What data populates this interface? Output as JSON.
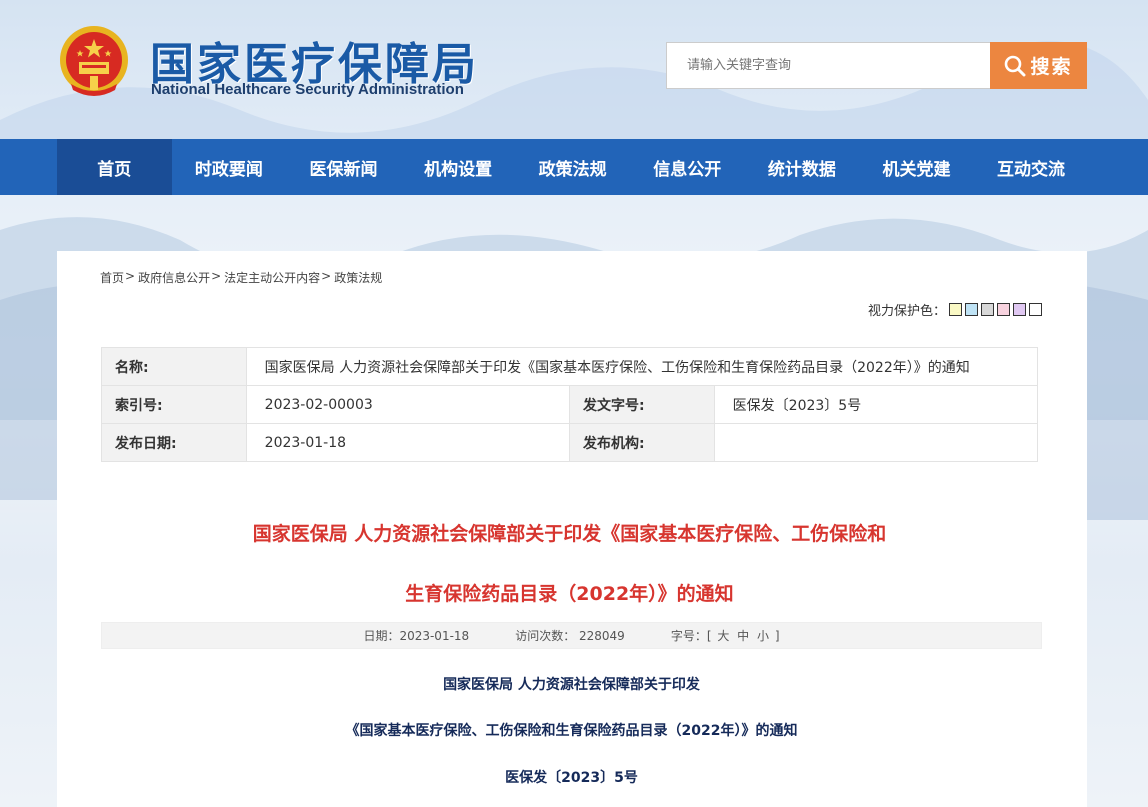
{
  "header": {
    "title_cn": "国家医疗保障局",
    "title_en": "National Healthcare Security Administration",
    "search_placeholder": "请输入关键字查询",
    "search_button": "搜索"
  },
  "nav": {
    "items": [
      "首页",
      "时政要闻",
      "医保新闻",
      "机构设置",
      "政策法规",
      "信息公开",
      "统计数据",
      "机关党建",
      "互动交流"
    ]
  },
  "breadcrumb": [
    "首页",
    "政府信息公开",
    "法定主动公开内容",
    "政策法规"
  ],
  "eye_protect": {
    "label": "视力保护色：",
    "colors": [
      "#faf9c5",
      "#bfe3f5",
      "#d8d8d8",
      "#f8d3df",
      "#e0c8f2",
      "#ffffff"
    ]
  },
  "info": {
    "name_label": "名称:",
    "name_value": "国家医保局 人力资源社会保障部关于印发《国家基本医疗保险、工伤保险和生育保险药品目录（2022年）》的通知",
    "index_label": "索引号:",
    "index_value": "2023-02-00003",
    "doc_no_label": "发文字号:",
    "doc_no_value": "医保发〔2023〕5号",
    "date_label": "发布日期:",
    "date_value": "2023-01-18",
    "org_label": "发布机构:",
    "org_value": ""
  },
  "article": {
    "title_line1": "国家医保局 人力资源社会保障部关于印发《国家基本医疗保险、工伤保险和",
    "title_line2": "生育保险药品目录（2022年）》的通知",
    "date_text": "日期：2023-01-18",
    "visits_text": "访问次数： 228049",
    "font_size_label": "字号：[",
    "size_large": "大",
    "size_medium": "中",
    "size_small": "小",
    "font_size_end": "]",
    "head_line1": "国家医保局  人力资源社会保障部关于印发",
    "head_line2": "《国家基本医疗保险、工伤保险和生育保险药品目录（2022年）》的通知",
    "head_line3": "医保发〔2023〕5号"
  }
}
